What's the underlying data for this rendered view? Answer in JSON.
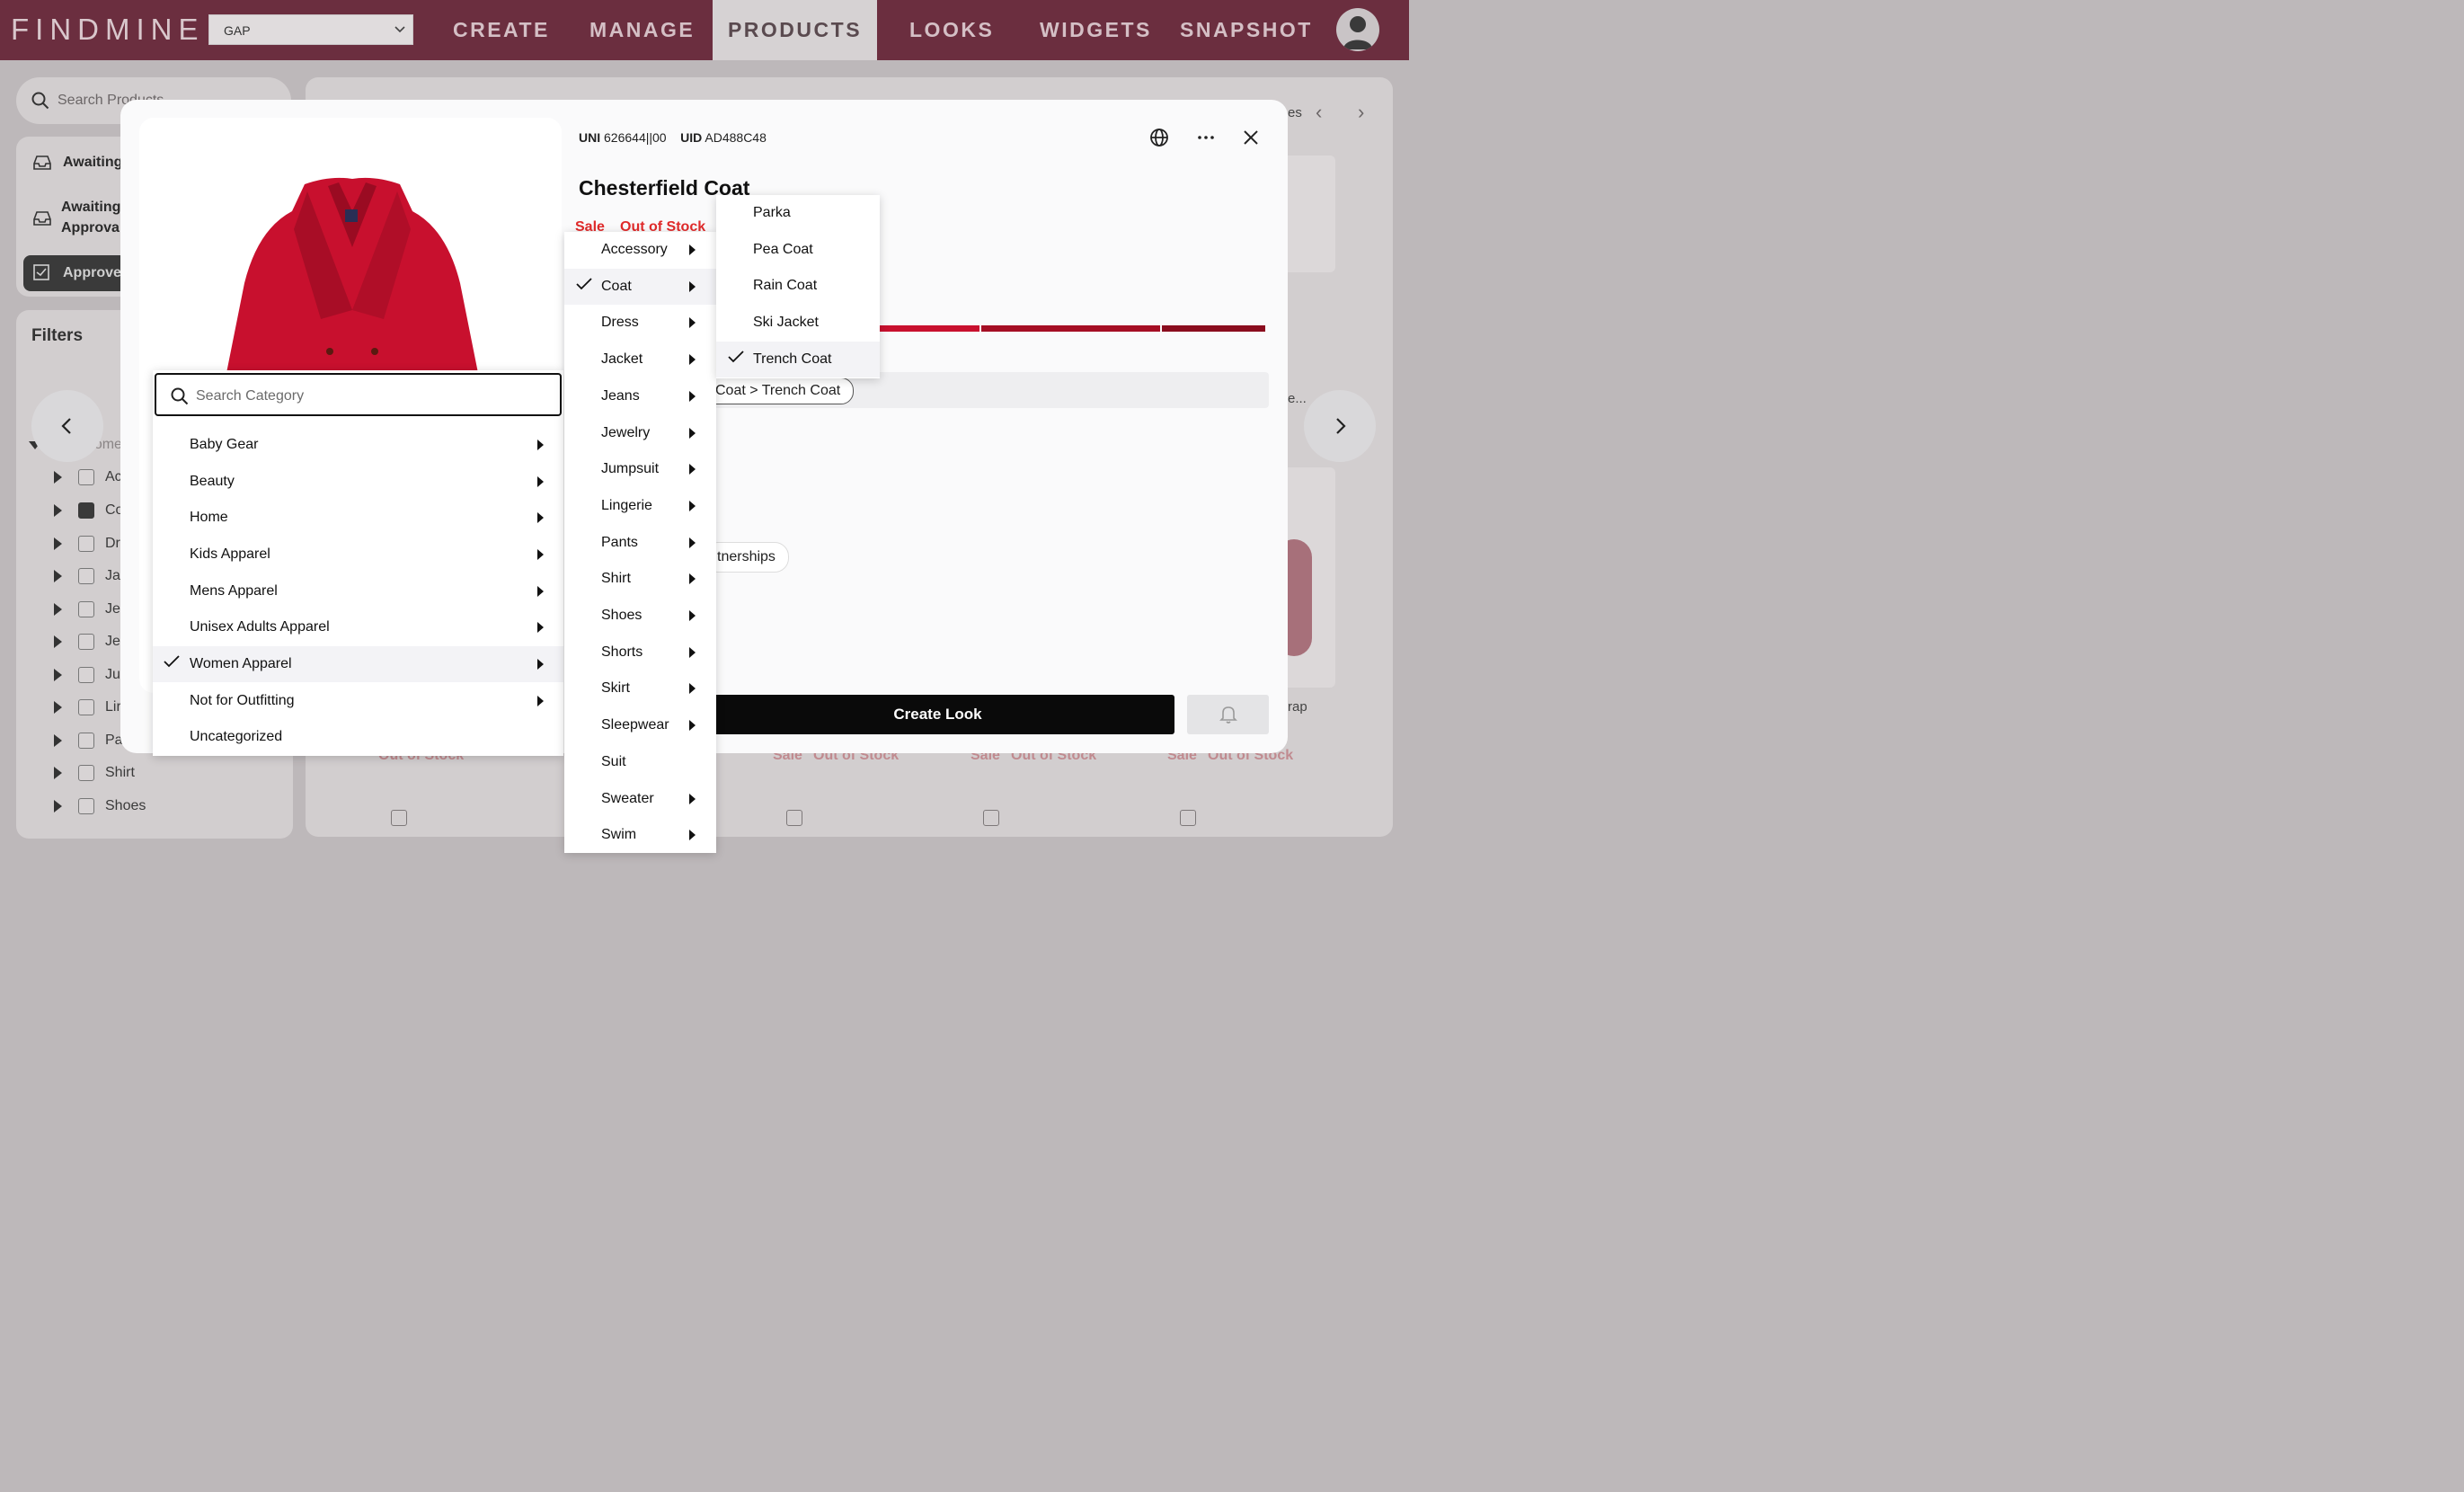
{
  "topbar": {
    "logo": "FINDMINE",
    "brand_select": "GAP",
    "nav": [
      "CREATE",
      "MANAGE",
      "PRODUCTS",
      "LOOKS",
      "WIDGETS",
      "SNAPSHOT"
    ],
    "active_nav": "PRODUCTS"
  },
  "sidebar": {
    "search_placeholder": "Search Products",
    "items": [
      "Awaiting",
      "Awaiting",
      "Approva",
      "Approve"
    ],
    "filters_title": "Filters",
    "tree_root": "Wome",
    "tree": [
      "Ac",
      "Co",
      "Dr",
      "Ja",
      "Je",
      "Je",
      "Ju",
      "Lir",
      "Pa",
      "Shirt",
      "Shoes"
    ]
  },
  "background": {
    "sale_labels": [
      "Out of Stock",
      "Sale",
      "Out of Stock",
      "Sale",
      "Out of Stock",
      "Sale",
      "Out of Stock"
    ],
    "side_texts": [
      "es",
      "e...",
      "rap"
    ]
  },
  "modal": {
    "uni_label": "UNI",
    "uni_value": "626644||00",
    "uid_label": "UID",
    "uid_value": "AD488C48",
    "title": "Chesterfield Coat",
    "sale": "Sale",
    "out_of_stock": "Out of Stock",
    "category_pill": "Coat > Trench Coat",
    "partner_pill": "tnerships",
    "create_look": "Create Look"
  },
  "category_menu": {
    "search_placeholder": "Search Category",
    "level1": [
      {
        "label": "Baby Gear",
        "has_sub": true
      },
      {
        "label": "Beauty",
        "has_sub": true
      },
      {
        "label": "Home",
        "has_sub": true
      },
      {
        "label": "Kids Apparel",
        "has_sub": true
      },
      {
        "label": "Mens Apparel",
        "has_sub": true
      },
      {
        "label": "Unisex Adults Apparel",
        "has_sub": true
      },
      {
        "label": "Women Apparel",
        "has_sub": true,
        "selected": true
      },
      {
        "label": "Not for Outfitting",
        "has_sub": true
      },
      {
        "label": "Uncategorized",
        "has_sub": false
      }
    ],
    "level2": [
      {
        "label": "Accessory",
        "has_sub": true
      },
      {
        "label": "Coat",
        "has_sub": true,
        "selected": true
      },
      {
        "label": "Dress",
        "has_sub": true
      },
      {
        "label": "Jacket",
        "has_sub": true
      },
      {
        "label": "Jeans",
        "has_sub": true
      },
      {
        "label": "Jewelry",
        "has_sub": true
      },
      {
        "label": "Jumpsuit",
        "has_sub": true
      },
      {
        "label": "Lingerie",
        "has_sub": true
      },
      {
        "label": "Pants",
        "has_sub": true
      },
      {
        "label": "Shirt",
        "has_sub": true
      },
      {
        "label": "Shoes",
        "has_sub": true
      },
      {
        "label": "Shorts",
        "has_sub": true
      },
      {
        "label": "Skirt",
        "has_sub": true
      },
      {
        "label": "Sleepwear",
        "has_sub": true
      },
      {
        "label": "Suit",
        "has_sub": false
      },
      {
        "label": "Sweater",
        "has_sub": true
      },
      {
        "label": "Swim",
        "has_sub": true
      }
    ],
    "level3": [
      {
        "label": "Parka"
      },
      {
        "label": "Pea Coat"
      },
      {
        "label": "Rain Coat"
      },
      {
        "label": "Ski Jacket"
      },
      {
        "label": "Trench Coat",
        "selected": true
      }
    ]
  },
  "colors": {
    "topbar": "#6b2e3f",
    "sale_red": "#e02a2a",
    "bar1": "#c8102e",
    "bar2": "#a50e24",
    "bar3": "#8a0c1e"
  }
}
